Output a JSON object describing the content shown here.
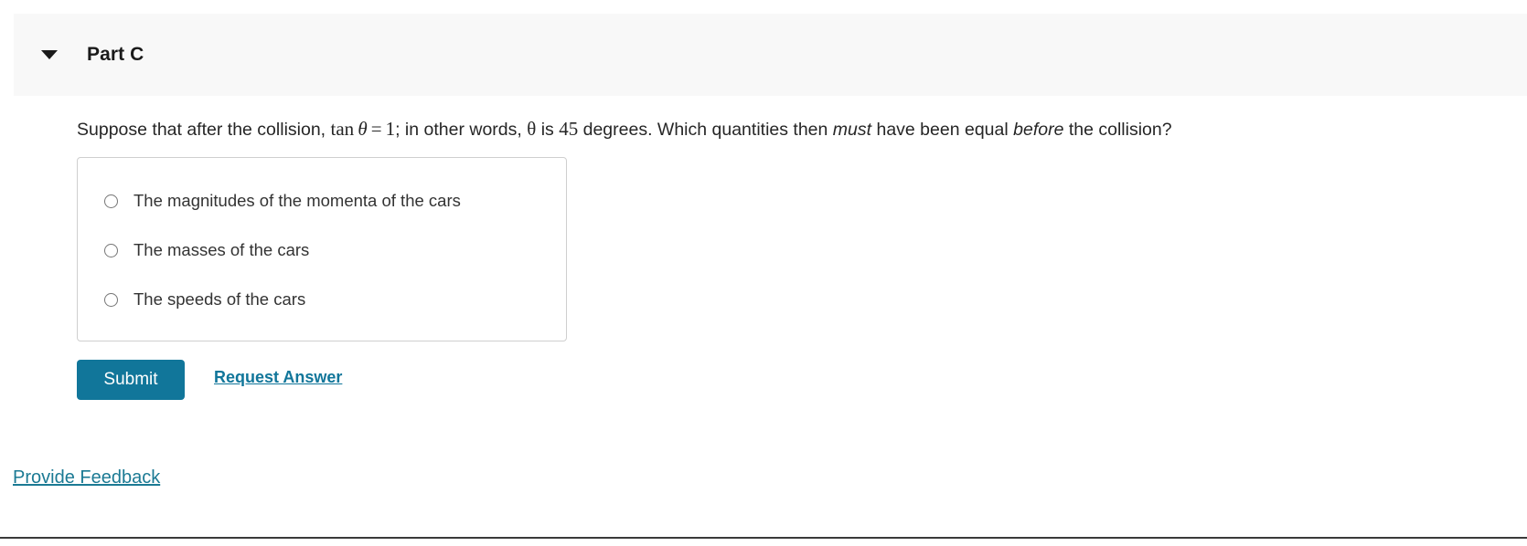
{
  "part_header": {
    "title": "Part C",
    "collapse_icon": "triangle-down-icon",
    "background_color": "#f8f8f8"
  },
  "question": {
    "text_before_math": "Suppose that after the collision, ",
    "math_1": {
      "fn": "tan",
      "variable": "θ",
      "operator": "=",
      "number": "1"
    },
    "text_middle": "; in other words, ",
    "math_variable_2": "θ",
    "text_is": " is ",
    "math_number_2": "45",
    "text_after": " degrees. Which quantities then ",
    "emphasis_1": "must",
    "text_after_emph1": " have been equal ",
    "emphasis_2": "before",
    "text_end": " the collision?"
  },
  "choices": {
    "items": [
      {
        "label": "The magnitudes of the momenta of the cars",
        "selected": false
      },
      {
        "label": "The masses of the cars",
        "selected": false
      },
      {
        "label": "The speeds of the cars",
        "selected": false
      }
    ]
  },
  "actions": {
    "submit_label": "Submit",
    "submit_color": "#11769a",
    "request_answer_label": "Request Answer",
    "link_color": "#11769a"
  },
  "footer": {
    "provide_feedback_label": "Provide Feedback",
    "link_color": "#1b7a94"
  }
}
